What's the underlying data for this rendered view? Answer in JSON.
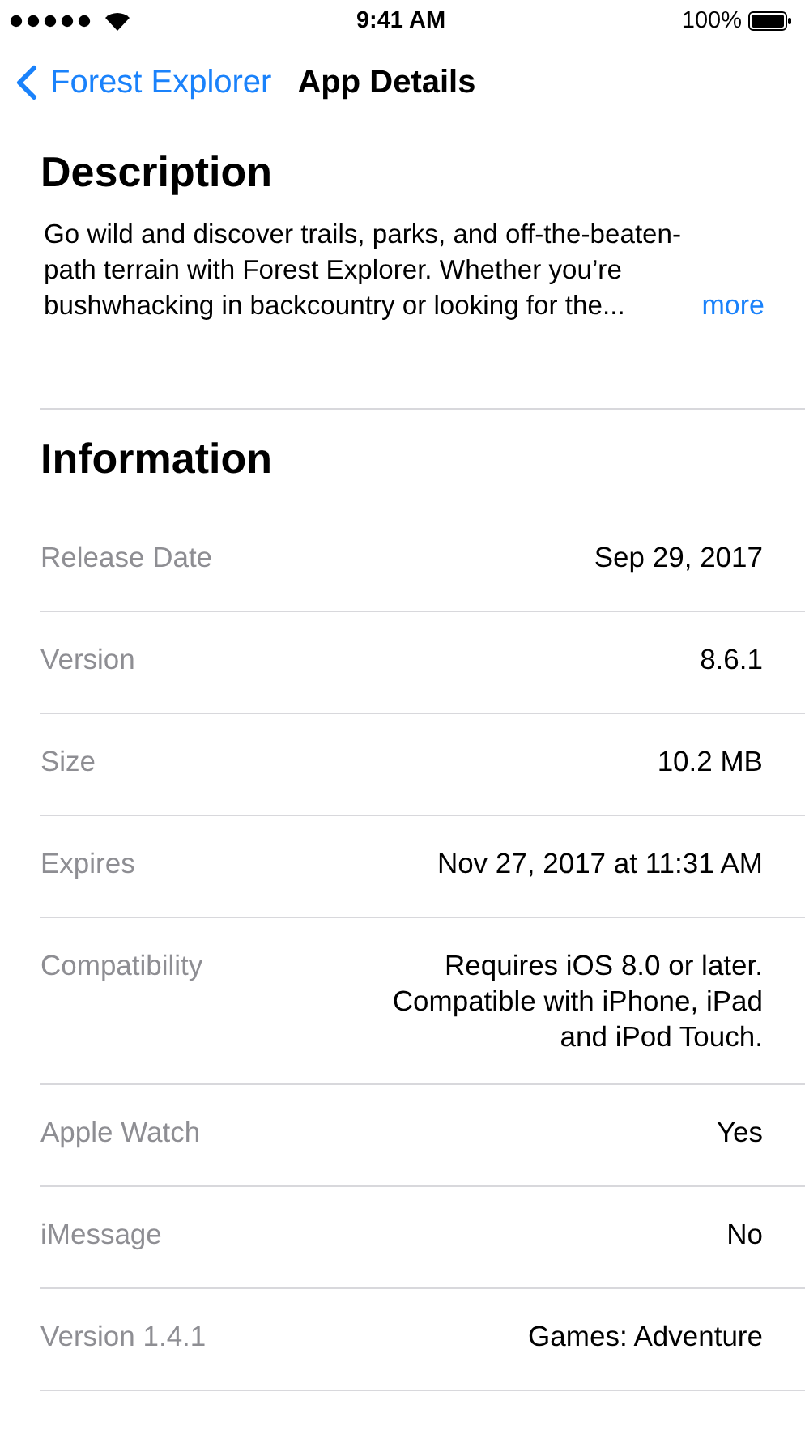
{
  "status_bar": {
    "time": "9:41 AM",
    "battery": "100%"
  },
  "nav": {
    "back": "Forest Explorer",
    "title": "App Details"
  },
  "description": {
    "heading": "Description",
    "text": "Go wild and discover trails, parks, and off-the-beaten-\npath terrain with Forest Explorer. Whether you’re\nbushwhacking in backcountry or looking for the...",
    "more": "more"
  },
  "information": {
    "heading": "Information",
    "rows": [
      {
        "label": "Release Date",
        "value": "Sep 29, 2017"
      },
      {
        "label": "Version",
        "value": "8.6.1"
      },
      {
        "label": "Size",
        "value": "10.2 MB"
      },
      {
        "label": "Expires",
        "value": "Nov 27, 2017 at 11:31 AM"
      },
      {
        "label": "Compatibility",
        "value": "Requires iOS 8.0 or later.\nCompatible with iPhone, iPad\nand iPod Touch."
      },
      {
        "label": "Apple Watch",
        "value": "Yes"
      },
      {
        "label": "iMessage",
        "value": "No"
      },
      {
        "label": "Version 1.4.1",
        "value": "Games: Adventure"
      }
    ]
  }
}
